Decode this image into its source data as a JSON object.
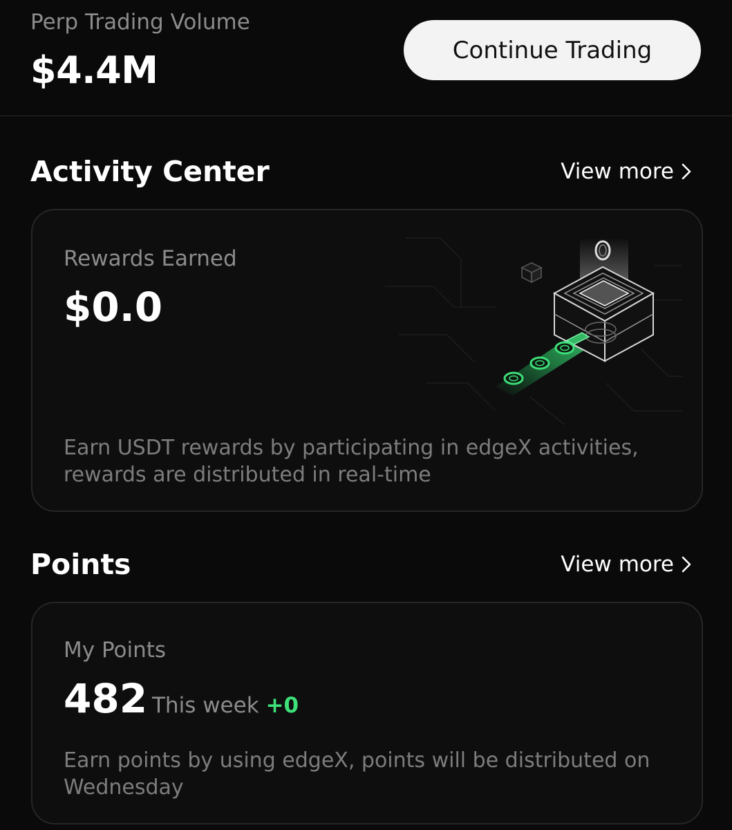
{
  "header": {
    "volume_label": "Perp Trading Volume",
    "volume_value": "$4.4M",
    "continue_button": "Continue Trading"
  },
  "activity": {
    "title": "Activity Center",
    "view_more": "View more",
    "card": {
      "label": "Rewards Earned",
      "value": "$0.0",
      "description": "Earn USDT rewards by participating in edgeX activities, rewards are distributed in real-time",
      "illustration_icon": "reward-box-icon"
    }
  },
  "points": {
    "title": "Points",
    "view_more": "View more",
    "card": {
      "label": "My Points",
      "value": "482",
      "week_label": "This week",
      "week_delta": "+0",
      "description": "Earn points by using edgeX, points will be distributed on Wednesday"
    }
  },
  "colors": {
    "background": "#0a0a0a",
    "accent_green": "#3ee07a",
    "button_bg": "#f3f3f3"
  }
}
